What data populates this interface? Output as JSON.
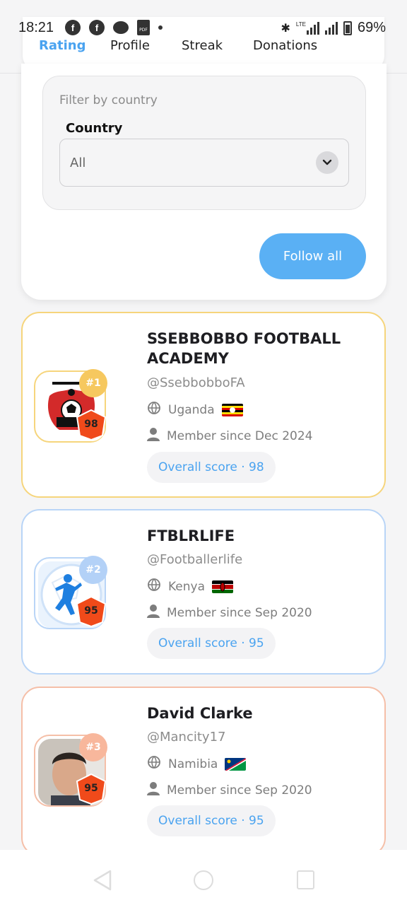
{
  "status_bar": {
    "time": "18:21",
    "left_icons": [
      "facebook-icon",
      "facebook-icon",
      "messenger-icon",
      "pdf-icon",
      "dot-icon"
    ],
    "right_icons": [
      "bluetooth-icon",
      "lte-signal-icon",
      "signal-icon",
      "battery-icon"
    ],
    "lte_label": "LTE",
    "battery": "69%"
  },
  "tabs": [
    {
      "label": "Rating",
      "active": true
    },
    {
      "label": "Profile",
      "active": false
    },
    {
      "label": "Streak",
      "active": false
    },
    {
      "label": "Donations",
      "active": false
    }
  ],
  "filter": {
    "title": "Filter by country",
    "country_label": "Country",
    "selected": "All"
  },
  "follow_all_label": "Follow all",
  "members": [
    {
      "rank": "#1",
      "score": "98",
      "name": "SSEBBOBBO FOOTBALL ACADEMY",
      "handle": "@SsebbobboFA",
      "country": "Uganda",
      "member_since": "Member since Dec 2024",
      "overall": "Overall score · 98",
      "avatar_text": "SSEBBOBBO FOOTBALL ACADEMY",
      "rank_color": "#f6c85f"
    },
    {
      "rank": "#2",
      "score": "95",
      "name": "FTBLRLIFE",
      "handle": "@Footballerlife",
      "country": "Kenya",
      "member_since": "Member since Sep 2020",
      "overall": "Overall score · 95",
      "rank_color": "#b3d1f7"
    },
    {
      "rank": "#3",
      "score": "95",
      "name": "David Clarke",
      "handle": "@Mancity17",
      "country": "Namibia",
      "member_since": "Member since Sep 2020",
      "overall": "Overall score · 95",
      "rank_color": "#f8b79c"
    }
  ],
  "colors": {
    "accent": "#4aa3f0",
    "follow_button": "#5ab0f4",
    "score_shield": "#f04a1a"
  }
}
